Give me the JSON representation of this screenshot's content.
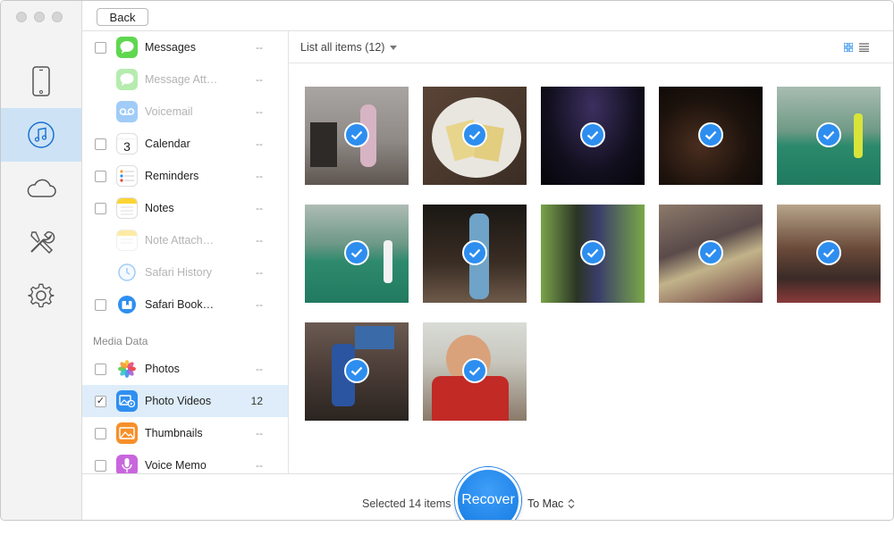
{
  "window": {
    "back_label": "Back"
  },
  "rail": {
    "items": [
      {
        "name": "device",
        "icon": "iphone-icon",
        "active": false
      },
      {
        "name": "itunes",
        "icon": "music-note-icon",
        "active": true
      },
      {
        "name": "icloud",
        "icon": "cloud-icon",
        "active": false
      },
      {
        "name": "tools",
        "icon": "tools-icon",
        "active": false
      },
      {
        "name": "settings",
        "icon": "gear-icon",
        "active": false
      }
    ]
  },
  "categories": [
    {
      "label": "Messages",
      "count": "--",
      "icon": "messages-icon",
      "dim": false,
      "checked": false
    },
    {
      "label": "Message Att…",
      "count": "--",
      "icon": "message-attachments-icon",
      "dim": true,
      "checked": false
    },
    {
      "label": "Voicemail",
      "count": "--",
      "icon": "voicemail-icon",
      "dim": true,
      "checked": false
    },
    {
      "label": "Calendar",
      "count": "--",
      "icon": "calendar-icon",
      "dim": false,
      "checked": false
    },
    {
      "label": "Reminders",
      "count": "--",
      "icon": "reminders-icon",
      "dim": false,
      "checked": false
    },
    {
      "label": "Notes",
      "count": "--",
      "icon": "notes-icon",
      "dim": false,
      "checked": false
    },
    {
      "label": "Note Attach…",
      "count": "--",
      "icon": "note-attachments-icon",
      "dim": true,
      "checked": false
    },
    {
      "label": "Safari History",
      "count": "--",
      "icon": "safari-history-icon",
      "dim": true,
      "checked": false
    },
    {
      "label": "Safari Book…",
      "count": "--",
      "icon": "safari-bookmarks-icon",
      "dim": false,
      "checked": false
    }
  ],
  "media_section_label": "Media Data",
  "media_categories": [
    {
      "label": "Photos",
      "count": "--",
      "icon": "photos-icon",
      "checked": false,
      "selected": false
    },
    {
      "label": "Photo Videos",
      "count": "12",
      "icon": "photo-videos-icon",
      "checked": true,
      "selected": true
    },
    {
      "label": "Thumbnails",
      "count": "--",
      "icon": "thumbnails-icon",
      "checked": false,
      "selected": false
    },
    {
      "label": "Voice Memo",
      "count": "--",
      "icon": "voice-memo-icon",
      "checked": false,
      "selected": false
    }
  ],
  "calendar_icon_day": "3",
  "main": {
    "list_filter_label": "List all items (12)",
    "thumbnails": [
      {
        "scene": "indoor room with person",
        "checked": true
      },
      {
        "scene": "plate of food",
        "checked": true
      },
      {
        "scene": "dark stage",
        "checked": true
      },
      {
        "scene": "dark restaurant",
        "checked": true
      },
      {
        "scene": "badminton court",
        "checked": true
      },
      {
        "scene": "badminton court players",
        "checked": true
      },
      {
        "scene": "night performer",
        "checked": true
      },
      {
        "scene": "wedding hall green",
        "checked": true
      },
      {
        "scene": "banquet stage",
        "checked": true
      },
      {
        "scene": "banquet guests",
        "checked": true
      },
      {
        "scene": "child in living room",
        "checked": true
      },
      {
        "scene": "child in red sweater",
        "checked": true
      }
    ]
  },
  "footer": {
    "selected_text": "Selected 14 items",
    "recover_label": "Recover",
    "destination_label": "To Mac"
  },
  "colors": {
    "accent": "#2d8ef0",
    "rail_active": "#cde3f5",
    "row_selected": "#deedf9"
  }
}
